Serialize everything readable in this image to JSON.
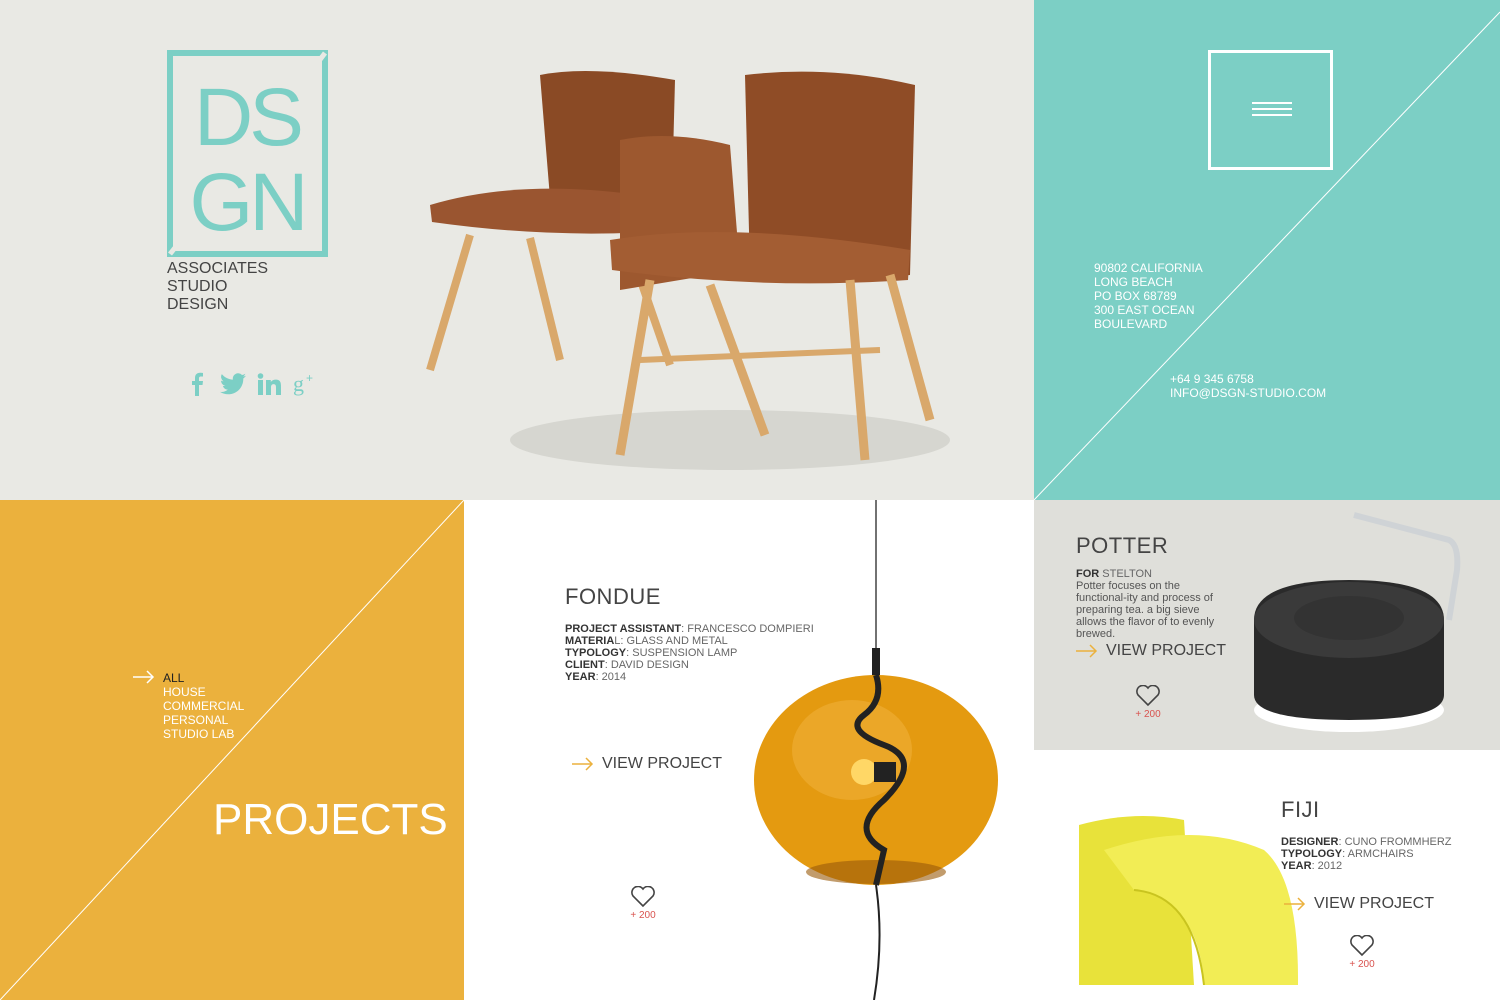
{
  "brand": {
    "logo_text": "DSGN",
    "tagline": [
      "ASSOCIATES",
      "STUDIO",
      "DESIGN"
    ],
    "accent": "#7ccfc5"
  },
  "socials": [
    {
      "name": "facebook-icon"
    },
    {
      "name": "twitter-icon"
    },
    {
      "name": "linkedin-icon"
    },
    {
      "name": "google-plus-icon"
    }
  ],
  "contact": {
    "address": [
      "90802 CALIFORNIA",
      "LONG BEACH",
      "PO BOX 68789",
      "300 EAST OCEAN",
      "BOULEVARD"
    ],
    "phone": "+64 9 345 6758",
    "email": "INFO@DSGN-STUDIO.COM"
  },
  "projects_nav": {
    "title": "PROJECTS",
    "filters": [
      "ALL",
      "HOUSE",
      "COMMERCIAL",
      "PERSONAL",
      "STUDIO LAB"
    ],
    "active": "ALL"
  },
  "fondue": {
    "title": "FONDUE",
    "assistant_label": "PROJECT ASSISTANT",
    "assistant": ": FRANCESCO DOMPIERI",
    "material_label": "MATERIA",
    "material": "L: GLASS AND METAL",
    "typology_label": "TYPOLOGY",
    "typology": ": SUSPENSION LAMP",
    "client_label": "CLIENT",
    "client": ": DAVID DESIGN",
    "year_label": "YEAR",
    "year": ": 2014",
    "view_label": "VIEW PROJECT",
    "likes": "+ 200"
  },
  "potter": {
    "title": "POTTER",
    "for_label": "FOR",
    "for": " STELTON",
    "description": "Potter focuses on the functional-ity and process of preparing tea. a big sieve allows the flavor of to evenly brewed.",
    "view_label": "VIEW PROJECT",
    "likes": "+ 200"
  },
  "fiji": {
    "title": "FIJI",
    "designer_label": "DESIGNER",
    "designer": ": CUNO FROMMHERZ",
    "typology_label": "TYPOLOGY",
    "typology": ": ARMCHAIRS",
    "year_label": "YEAR",
    "year": ": 2012",
    "view_label": "VIEW PROJECT",
    "likes": "+ 200"
  },
  "colors": {
    "hero_bg": "#e9e9e4",
    "teal": "#7ccfc5",
    "mustard": "#ebb13d",
    "like_red": "#d9534f",
    "arrow_orange": "#ebb13d"
  }
}
